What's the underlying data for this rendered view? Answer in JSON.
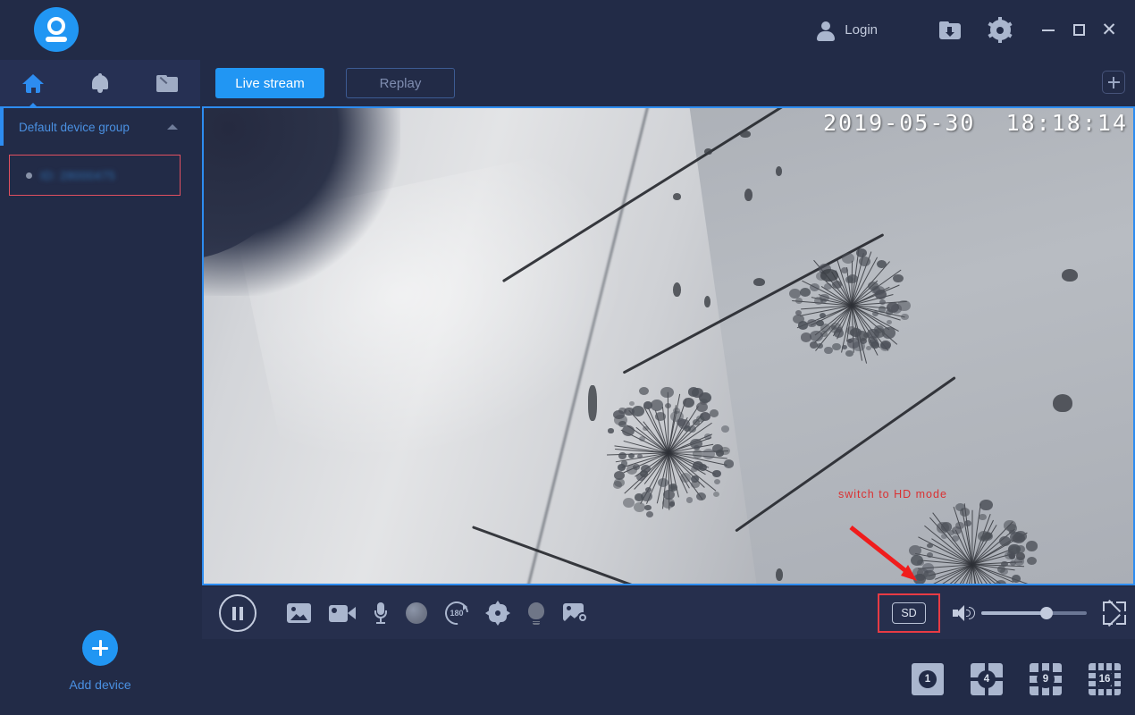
{
  "app": {
    "logo_icon": "camera-logo-icon",
    "accent_color": "#2196f3",
    "bg_color": "#222b47"
  },
  "titlebar": {
    "login_label": "Login",
    "person_icon": "person-icon",
    "download_icon": "download-folder-icon",
    "settings_icon": "gear-icon",
    "minimize_icon": "minimize-icon",
    "maximize_icon": "maximize-icon",
    "close_icon": "close-icon"
  },
  "sidebar": {
    "nav": [
      {
        "name": "home",
        "icon": "home-icon",
        "active": true
      },
      {
        "name": "alerts",
        "icon": "bell-icon",
        "active": false
      },
      {
        "name": "files",
        "icon": "folder-icon",
        "active": false
      }
    ],
    "group": {
      "title": "Default device group",
      "collapse_icon": "chevron-up-icon"
    },
    "devices": [
      {
        "id_text": "ID: 28000475",
        "status": "offline",
        "selected": true
      }
    ],
    "add_device": {
      "label": "Add device",
      "icon": "plus-icon"
    }
  },
  "main": {
    "tabs": [
      {
        "label": "Live stream",
        "active": true
      },
      {
        "label": "Replay",
        "active": false
      }
    ],
    "add_panel_icon": "plus-square-icon",
    "video": {
      "timestamp": "2019-05-30  18:18:14",
      "hint_text": "switch to HD mode",
      "arrow_icon": "red-arrow-annotation"
    },
    "controls": {
      "playpause": {
        "label": "pause",
        "icon": "pause-icon"
      },
      "items": [
        {
          "name": "snapshot",
          "icon": "snapshot-icon"
        },
        {
          "name": "record",
          "icon": "video-record-icon"
        },
        {
          "name": "microphone",
          "icon": "microphone-icon"
        },
        {
          "name": "alarm",
          "icon": "alarm-siren-icon"
        },
        {
          "name": "rotate-180",
          "icon": "rotate-180-icon",
          "label": "180"
        },
        {
          "name": "ptz",
          "icon": "ptz-direction-icon"
        },
        {
          "name": "light",
          "icon": "light-bulb-icon"
        },
        {
          "name": "image-settings",
          "icon": "image-settings-icon"
        }
      ],
      "quality": {
        "label": "SD",
        "highlighted": true,
        "highlight_color": "#e83b44"
      },
      "volume": {
        "icon": "volume-icon",
        "value": 62
      },
      "fullscreen": {
        "icon": "fullscreen-icon"
      }
    },
    "layouts": [
      {
        "label": "1",
        "name": "layout-1"
      },
      {
        "label": "4",
        "name": "layout-4"
      },
      {
        "label": "9",
        "name": "layout-9"
      },
      {
        "label": "16",
        "name": "layout-16"
      }
    ]
  }
}
